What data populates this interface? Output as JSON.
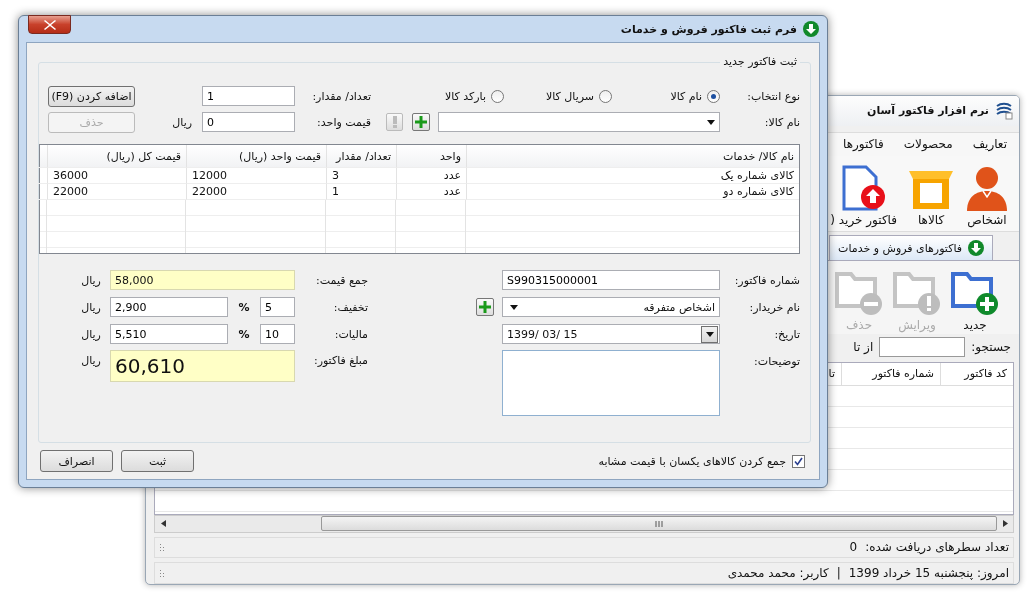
{
  "background_window": {
    "title": "نرم افزار فاکتور آسان",
    "menu": [
      "تعاریف",
      "محصولات",
      "فاکتورها"
    ],
    "ribbon": [
      {
        "label": "اشخاص",
        "kind": "person"
      },
      {
        "label": "کالاها",
        "kind": "box"
      },
      {
        "label": "فاکتور خرید (",
        "kind": "invoice"
      }
    ],
    "tabs": [
      {
        "label": "فاکتورهای فروش و خدمات",
        "selected": true
      }
    ],
    "toolbar": [
      {
        "label": "جدید",
        "kind": "new",
        "disabled": false
      },
      {
        "label": "ویرایش",
        "kind": "edit",
        "disabled": true
      },
      {
        "label": "حذف",
        "kind": "delete",
        "disabled": true
      }
    ],
    "search": {
      "label": "جستجو:",
      "range_label": "از تا"
    },
    "table": {
      "columns": [
        "کد فاکتور",
        "شماره فاکتور",
        "تا"
      ]
    },
    "row_count": {
      "label": "تعداد سطرهای دریافت شده:",
      "value": "0"
    },
    "status_bar": {
      "today": "امروز: پنجشنبه 15 خرداد 1399",
      "separator": "|",
      "user": "کاربر: محمد محمدی"
    }
  },
  "dialog": {
    "title": "فرم ثبت فاکتور فروش و خدمات",
    "group_title": "ثبت فاکتور جدید",
    "selection": {
      "label": "نوع انتخاب:",
      "options": [
        {
          "label": "نام کالا",
          "selected": true
        },
        {
          "label": "سریال کالا",
          "selected": false
        },
        {
          "label": "بارکد کالا",
          "selected": false
        }
      ]
    },
    "product": {
      "label": "نام کالا:",
      "warning_disabled": true
    },
    "quantity": {
      "label": "تعداد/ مقدار:",
      "value": "1"
    },
    "unit_price": {
      "label": "قیمت واحد:",
      "value": "0",
      "unit": "ریال"
    },
    "add_button": {
      "label": "اضافه کردن (F9)",
      "disabled": false
    },
    "delete_button": {
      "label": "حذف",
      "disabled": true
    },
    "items": {
      "columns": [
        "نام کالا/ خدمات",
        "واحد",
        "تعداد/ مقدار",
        "قیمت واحد (ریال)",
        "قیمت کل (ریال)"
      ],
      "rows": [
        [
          "کالای شماره یک",
          "عدد",
          "3",
          "12000",
          "36000"
        ],
        [
          "کالای شماره دو",
          "عدد",
          "1",
          "22000",
          "22000"
        ]
      ]
    },
    "invoice_number": {
      "label": "شماره فاکتور:",
      "value": "S990315000001"
    },
    "buyer": {
      "label": "نام خریدار:",
      "value": "اشخاص متفرقه"
    },
    "date": {
      "label": "تاریخ:",
      "value": "1399/ 03/ 15"
    },
    "notes": {
      "label": "توضیحات:"
    },
    "total": {
      "label": "جمع قیمت:",
      "value": "58,000",
      "unit": "ریال"
    },
    "discount": {
      "label": "تخفیف:",
      "percent": "5",
      "percent_sign": "%",
      "value": "2,900",
      "unit": "ریال"
    },
    "tax": {
      "label": "مالیات:",
      "percent": "10",
      "percent_sign": "%",
      "value": "5,510",
      "unit": "ریال"
    },
    "amount": {
      "label": "مبلغ فاکتور:",
      "value": "60,610",
      "unit": "ریال"
    },
    "merge_checkbox": {
      "label": "جمع کردن کالاهای یکسان با قیمت مشابه",
      "checked": true
    },
    "buttons": [
      {
        "label": "ثبت"
      },
      {
        "label": "انصراف"
      }
    ]
  }
}
